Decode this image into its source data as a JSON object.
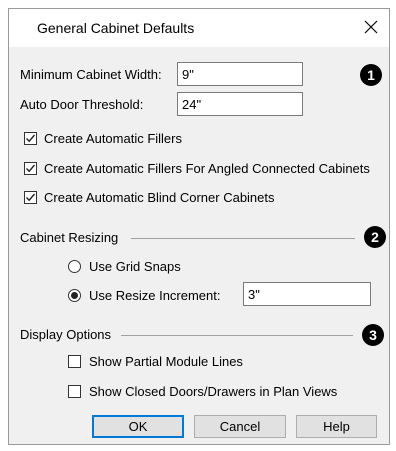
{
  "dialog": {
    "title": "General Cabinet Defaults",
    "close_glyph": "✕"
  },
  "defaults": {
    "min_width_label": "Minimum Cabinet Width:",
    "min_width_value": "9\"",
    "auto_door_label": "Auto Door Threshold:",
    "auto_door_value": "24\"",
    "checkbox_fillers": {
      "label": "Create Automatic Fillers",
      "checked": true
    },
    "checkbox_angled": {
      "label": "Create Automatic Fillers For Angled Connected Cabinets",
      "checked": true
    },
    "checkbox_blind": {
      "label": "Create Automatic Blind Corner Cabinets",
      "checked": true
    }
  },
  "resizing": {
    "group_label": "Cabinet Resizing",
    "radio_grid": {
      "label": "Use Grid Snaps",
      "selected": false
    },
    "radio_increment": {
      "label": "Use Resize Increment:",
      "selected": true
    },
    "increment_value": "3\""
  },
  "display": {
    "group_label": "Display Options",
    "checkbox_partial": {
      "label": "Show Partial Module Lines",
      "checked": false
    },
    "checkbox_closed": {
      "label": "Show Closed Doors/Drawers in Plan Views",
      "checked": false
    }
  },
  "callouts": [
    "1",
    "2",
    "3"
  ],
  "buttons": {
    "ok": "OK",
    "cancel": "Cancel",
    "help": "Help"
  },
  "colors": {
    "accent": "#0078d7",
    "dialog_bg": "#f0f0f0",
    "callout": "#000000"
  }
}
